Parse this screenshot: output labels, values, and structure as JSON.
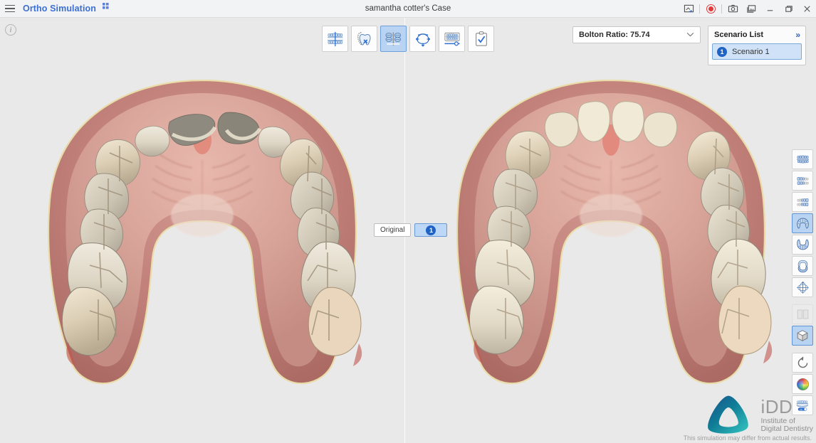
{
  "titlebar": {
    "menu_icon": "hamburger-menu-icon",
    "app_title": "Ortho Simulation",
    "pin_icon": "pin-icon",
    "case_title": "samantha cotter's Case",
    "tools": [
      {
        "name": "screen-capture-icon",
        "label": ""
      },
      {
        "name": "record-icon",
        "label": ""
      },
      {
        "name": "camera-icon",
        "label": ""
      },
      {
        "name": "gallery-icon",
        "label": ""
      },
      {
        "name": "minimize-icon",
        "label": "—"
      },
      {
        "name": "maximize-icon",
        "label": "❐"
      },
      {
        "name": "close-icon",
        "label": "✕"
      }
    ]
  },
  "toolbar": {
    "buttons": [
      {
        "name": "tool-braces-alignment",
        "title": "Alignment",
        "active": false
      },
      {
        "name": "tool-tooth-extraction",
        "title": "Extraction",
        "active": false
      },
      {
        "name": "tool-compare-view",
        "title": "Compare",
        "active": true
      },
      {
        "name": "tool-rotate-3d",
        "title": "Rotate",
        "active": false
      },
      {
        "name": "tool-timeline-slider",
        "title": "Timeline",
        "active": false
      },
      {
        "name": "tool-approve-report",
        "title": "Report",
        "active": false
      }
    ]
  },
  "bolton": {
    "label": "Bolton Ratio: 75.74",
    "chevron": "⌄"
  },
  "scenario": {
    "title": "Scenario List",
    "expand_icon": "»",
    "items": [
      {
        "number": "1",
        "label": "Scenario 1",
        "selected": true
      }
    ]
  },
  "viewport": {
    "info_icon": "info-icon",
    "panes": [
      {
        "name": "pane-original",
        "tag": "Original",
        "selected": false,
        "model": "maxillary-arch-original"
      },
      {
        "name": "pane-scenario-1",
        "tag": "1",
        "selected": true,
        "model": "maxillary-arch-simulated"
      }
    ]
  },
  "rail": {
    "buttons": [
      {
        "name": "view-front-icon",
        "active": false,
        "disabled": false
      },
      {
        "name": "view-right-lateral-icon",
        "active": false,
        "disabled": false
      },
      {
        "name": "view-left-lateral-icon",
        "active": false,
        "disabled": false
      },
      {
        "name": "view-upper-occlusal-icon",
        "active": true,
        "disabled": false
      },
      {
        "name": "view-lower-occlusal-icon",
        "active": false,
        "disabled": false
      },
      {
        "name": "view-both-arches-icon",
        "active": false,
        "disabled": false
      },
      {
        "name": "view-orientation-axes-icon",
        "active": false,
        "disabled": false
      },
      {
        "name": "split-panes-icon",
        "active": false,
        "disabled": true
      },
      {
        "name": "3d-cube-icon",
        "active": true,
        "disabled": false
      },
      {
        "name": "reset-view-icon",
        "active": false,
        "disabled": false
      },
      {
        "name": "color-wheel-icon",
        "active": false,
        "disabled": false
      },
      {
        "name": "gingiva-toggle-icon",
        "active": false,
        "disabled": false
      }
    ]
  },
  "branding": {
    "logo_name": "idd-logo",
    "name": "iDD",
    "line1": "Institute of",
    "line2": "Digital Dentistry",
    "disclaimer": "This simulation may differ from actual results."
  },
  "colors": {
    "accent_blue": "#3b6fd4",
    "selection_blue": "#b9d4f2",
    "record_red": "#e03b3b",
    "gingiva": "#c08178",
    "background": "#e9e9e9"
  }
}
